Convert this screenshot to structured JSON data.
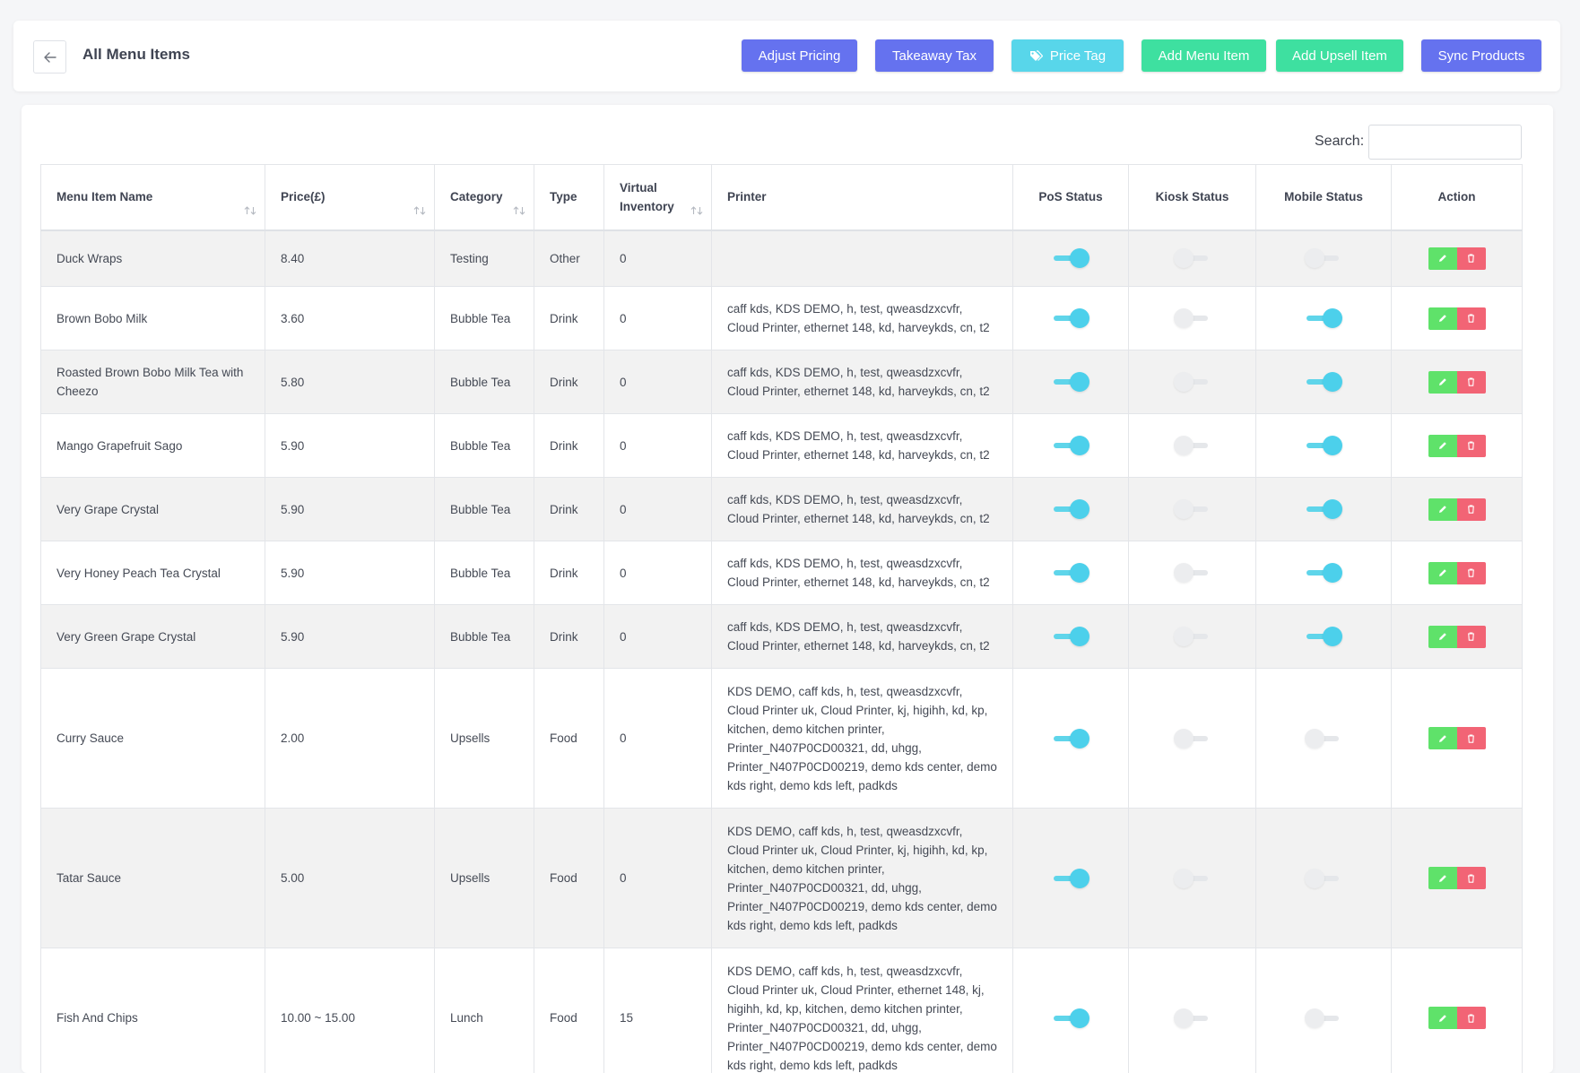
{
  "header": {
    "title": "All Menu Items",
    "buttons": [
      {
        "label": "Adjust Pricing",
        "color": "#6572ef"
      },
      {
        "label": "Takeaway Tax",
        "color": "#6572ef"
      },
      {
        "label": "Price Tag",
        "color": "#58d6ea"
      },
      {
        "label": "Add Menu Item",
        "color": "#3ee0a0"
      },
      {
        "label": "Add Upsell Item",
        "color": "#3ee0a0"
      },
      {
        "label": "Sync Products",
        "color": "#6572ef"
      }
    ]
  },
  "search": {
    "label": "Search:",
    "value": ""
  },
  "table": {
    "columns": {
      "name": "Menu Item Name",
      "price": "Price(£)",
      "category": "Category",
      "type": "Type",
      "inventory_line1": "Virtual",
      "inventory_line2": "Inventory",
      "printer": "Printer",
      "pos": "PoS Status",
      "kiosk": "Kiosk Status",
      "mobile": "Mobile Status",
      "action": "Action"
    },
    "rows": [
      {
        "name": "Duck Wraps",
        "price": "8.40",
        "category": "Testing",
        "type": "Other",
        "inventory": "0",
        "printer": "",
        "pos": true,
        "kiosk": false,
        "mobile": false
      },
      {
        "name": "Brown Bobo Milk",
        "price": "3.60",
        "category": "Bubble Tea",
        "type": "Drink",
        "inventory": "0",
        "printer": "caff kds, KDS DEMO, h, test, qweasdzxcvfr, Cloud Printer, ethernet 148, kd, harveykds, cn, t2",
        "pos": true,
        "kiosk": false,
        "mobile": true
      },
      {
        "name": "Roasted Brown Bobo Milk Tea with Cheezo",
        "price": "5.80",
        "category": "Bubble Tea",
        "type": "Drink",
        "inventory": "0",
        "printer": "caff kds, KDS DEMO, h, test, qweasdzxcvfr, Cloud Printer, ethernet 148, kd, harveykds, cn, t2",
        "pos": true,
        "kiosk": false,
        "mobile": true
      },
      {
        "name": "Mango Grapefruit Sago",
        "price": "5.90",
        "category": "Bubble Tea",
        "type": "Drink",
        "inventory": "0",
        "printer": "caff kds, KDS DEMO, h, test, qweasdzxcvfr, Cloud Printer, ethernet 148, kd, harveykds, cn, t2",
        "pos": true,
        "kiosk": false,
        "mobile": true
      },
      {
        "name": "Very Grape Crystal",
        "price": "5.90",
        "category": "Bubble Tea",
        "type": "Drink",
        "inventory": "0",
        "printer": "caff kds, KDS DEMO, h, test, qweasdzxcvfr, Cloud Printer, ethernet 148, kd, harveykds, cn, t2",
        "pos": true,
        "kiosk": false,
        "mobile": true
      },
      {
        "name": "Very Honey Peach Tea Crystal",
        "price": "5.90",
        "category": "Bubble Tea",
        "type": "Drink",
        "inventory": "0",
        "printer": "caff kds, KDS DEMO, h, test, qweasdzxcvfr, Cloud Printer, ethernet 148, kd, harveykds, cn, t2",
        "pos": true,
        "kiosk": false,
        "mobile": true
      },
      {
        "name": "Very Green Grape Crystal",
        "price": "5.90",
        "category": "Bubble Tea",
        "type": "Drink",
        "inventory": "0",
        "printer": "caff kds, KDS DEMO, h, test, qweasdzxcvfr, Cloud Printer, ethernet 148, kd, harveykds, cn, t2",
        "pos": true,
        "kiosk": false,
        "mobile": true
      },
      {
        "name": "Curry Sauce",
        "price": "2.00",
        "category": "Upsells",
        "type": "Food",
        "inventory": "0",
        "printer": "KDS DEMO, caff kds, h, test, qweasdzxcvfr, Cloud Printer uk, Cloud Printer, kj, higihh, kd, kp, kitchen, demo kitchen printer, Printer_N407P0CD00321, dd, uhgg, Printer_N407P0CD00219, demo kds center, demo kds right, demo kds left, padkds",
        "pos": true,
        "kiosk": false,
        "mobile": false
      },
      {
        "name": "Tatar Sauce",
        "price": "5.00",
        "category": "Upsells",
        "type": "Food",
        "inventory": "0",
        "printer": "KDS DEMO, caff kds, h, test, qweasdzxcvfr, Cloud Printer uk, Cloud Printer, kj, higihh, kd, kp, kitchen, demo kitchen printer, Printer_N407P0CD00321, dd, uhgg, Printer_N407P0CD00219, demo kds center, demo kds right, demo kds left, padkds",
        "pos": true,
        "kiosk": false,
        "mobile": false
      },
      {
        "name": "Fish And Chips",
        "price": "10.00 ~ 15.00",
        "category": "Lunch",
        "type": "Food",
        "inventory": "15",
        "printer": "KDS DEMO, caff kds, h, test, qweasdzxcvfr, Cloud Printer uk, Cloud Printer, ethernet 148, kj, higihh, kd, kp, kitchen, demo kitchen printer, Printer_N407P0CD00321, dd, uhgg, Printer_N407P0CD00219, demo kds center, demo kds right, demo kds left, padkds",
        "pos": true,
        "kiosk": false,
        "mobile": false
      }
    ]
  }
}
